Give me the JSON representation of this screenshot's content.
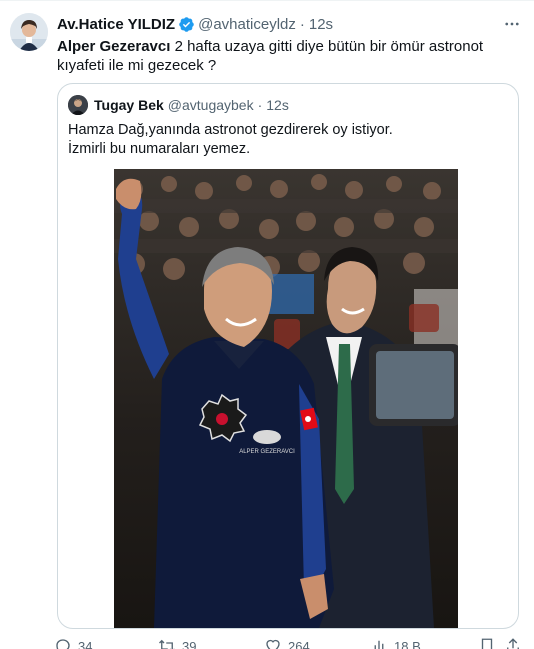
{
  "tweet": {
    "author_name": "Av.Hatice YILDIZ",
    "author_handle": "@avhaticeyldz",
    "separator": "·",
    "time": "12s",
    "mention": "Alper Gezeravcı",
    "text": " 2 hafta uzaya gitti diye bütün bir ömür astronot kıyafeti ile mi gezecek ?"
  },
  "quoted": {
    "author_name": "Tugay Bek",
    "author_handle": "@avtugaybek",
    "separator": "·",
    "time": "12s",
    "line1": "Hamza Dağ,yanında astronot gezdirerek oy istiyor.",
    "line2": "İzmirli bu numaraları yemez.",
    "photo_patch_text": "ALPER GEZERAVCI"
  },
  "actions": {
    "replies": "34",
    "retweets": "39",
    "likes": "264",
    "views": "18 B"
  },
  "colors": {
    "verified": "#1d9bf0",
    "text": "#0f1419",
    "secondary": "#536471",
    "border": "#cfd9de"
  }
}
